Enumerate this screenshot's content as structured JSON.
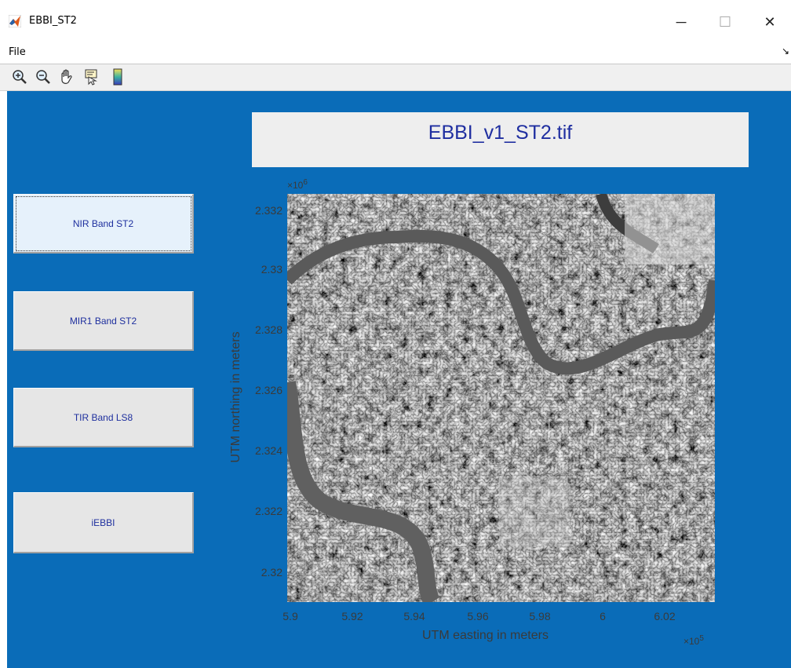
{
  "window": {
    "title": "EBBI_ST2",
    "minimize_glyph": "─",
    "maximize_glyph": "☐",
    "close_glyph": "✕"
  },
  "menubar": {
    "file_label": "File",
    "overflow_glyph": "↘"
  },
  "toolbar": {
    "icons": [
      "zoom-in-icon",
      "zoom-out-icon",
      "pan-icon",
      "data-cursor-icon",
      "colorbar-icon"
    ]
  },
  "colors": {
    "figure_bg": "#0a6cb8",
    "button_text": "#1e2f9e",
    "title_text": "#1f2ea0",
    "axis_text": "#3a3a3a"
  },
  "panel": {
    "title": "EBBI_v1_ST2.tif"
  },
  "buttons": [
    {
      "label": "NIR Band ST2",
      "active": true
    },
    {
      "label": "MIR1 Band ST2",
      "active": false
    },
    {
      "label": "TIR Band LS8",
      "active": false
    },
    {
      "label": "iEBBI",
      "active": false
    }
  ],
  "plot": {
    "ylabel": "UTM northing in meters",
    "xlabel": "UTM easting in meters",
    "y_exponent": "×10",
    "y_exponent_power": "6",
    "x_exponent": "×10",
    "x_exponent_power": "5",
    "yticks": [
      "2.332",
      "2.33",
      "2.328",
      "2.326",
      "2.324",
      "2.322",
      "2.32"
    ],
    "xticks": [
      "5.9",
      "5.92",
      "5.94",
      "5.96",
      "5.98",
      "6",
      "6.02"
    ],
    "image_description_icon": "grayscale-satellite-image"
  }
}
